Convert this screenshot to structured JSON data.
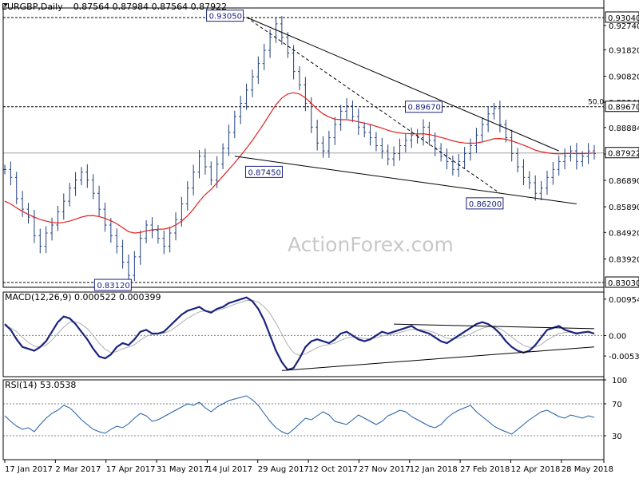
{
  "chart_data": {
    "type": "line",
    "main": {
      "title": "EURGBP,Daily",
      "ohlc": "0.87564 0.87984 0.87564 0.87922",
      "ylim": [
        0.8285,
        0.934
      ],
      "price_ticks": [
        "0.92740",
        "0.91820",
        "0.90820",
        "0.89840",
        "0.88884",
        "0.87880",
        "0.86890",
        "0.85890",
        "0.84920",
        "0.83920"
      ],
      "current_price": "0.87922",
      "level_labels": [
        {
          "text": "0.93040",
          "value": 0.9304,
          "style": "dashed"
        },
        {
          "text": "0.89670",
          "value": 0.8967,
          "style": "dashed",
          "fib_label": "50.0"
        },
        {
          "text": "0.83030",
          "value": 0.8303,
          "style": "dashed"
        }
      ],
      "annotations": [
        {
          "text": "0.93050",
          "date_index": 215,
          "value": 0.9305
        },
        {
          "text": "0.89670",
          "date_index": 365,
          "value": 0.8967
        },
        {
          "text": "0.87450",
          "date_index": 235,
          "value": 0.8745
        },
        {
          "text": "0.86200",
          "date_index": 415,
          "value": 0.862
        },
        {
          "text": "0.83120",
          "date_index": 90,
          "value": 0.8312
        }
      ],
      "series": [
        {
          "type": "ohlc_bars",
          "color": "#1f3f7f",
          "values": [
            0.873,
            0.87,
            0.862,
            0.858,
            0.855,
            0.848,
            0.844,
            0.849,
            0.852,
            0.857,
            0.861,
            0.866,
            0.869,
            0.872,
            0.869,
            0.864,
            0.858,
            0.852,
            0.848,
            0.844,
            0.838,
            0.833,
            0.84,
            0.847,
            0.852,
            0.85,
            0.847,
            0.844,
            0.849,
            0.854,
            0.86,
            0.866,
            0.872,
            0.878,
            0.874,
            0.869,
            0.875,
            0.881,
            0.887,
            0.893,
            0.898,
            0.903,
            0.908,
            0.913,
            0.918,
            0.923,
            0.928,
            0.923,
            0.917,
            0.91,
            0.905,
            0.898,
            0.889,
            0.883,
            0.88,
            0.885,
            0.89,
            0.895,
            0.897,
            0.893,
            0.889,
            0.887,
            0.885,
            0.882,
            0.88,
            0.877,
            0.879,
            0.882,
            0.884,
            0.886,
            0.885,
            0.889,
            0.884,
            0.881,
            0.878,
            0.876,
            0.873,
            0.876,
            0.879,
            0.882,
            0.886,
            0.89,
            0.894,
            0.896,
            0.89,
            0.885,
            0.879,
            0.874,
            0.87,
            0.868,
            0.864,
            0.866,
            0.87,
            0.873,
            0.876,
            0.878,
            0.88,
            0.876,
            0.878,
            0.88,
            0.879
          ]
        },
        {
          "type": "moving_average",
          "color": "#e02020",
          "values": [
            0.861,
            0.86,
            0.8585,
            0.8572,
            0.856,
            0.855,
            0.8541,
            0.8535,
            0.853,
            0.8528,
            0.853,
            0.8535,
            0.8542,
            0.855,
            0.8555,
            0.8556,
            0.8552,
            0.8545,
            0.8536,
            0.8525,
            0.851,
            0.8495,
            0.849,
            0.8492,
            0.8498,
            0.8502,
            0.8504,
            0.8505,
            0.851,
            0.852,
            0.8535,
            0.8555,
            0.858,
            0.861,
            0.8635,
            0.8655,
            0.868,
            0.8705,
            0.873,
            0.8755,
            0.8782,
            0.881,
            0.884,
            0.8872,
            0.8905,
            0.894,
            0.8975,
            0.9,
            0.9015,
            0.902,
            0.9015,
            0.9,
            0.898,
            0.8958,
            0.894,
            0.8928,
            0.892,
            0.8918,
            0.8918,
            0.8915,
            0.891,
            0.8905,
            0.89,
            0.8893,
            0.8886,
            0.8878,
            0.8872,
            0.8868,
            0.8866,
            0.8865,
            0.8864,
            0.8865,
            0.8862,
            0.8857,
            0.8851,
            0.8845,
            0.8838,
            0.8833,
            0.883,
            0.8829,
            0.883,
            0.8834,
            0.884,
            0.8846,
            0.8847,
            0.8844,
            0.8838,
            0.883,
            0.8822,
            0.8813,
            0.8803,
            0.8797,
            0.8793,
            0.879,
            0.8789,
            0.879,
            0.8791,
            0.879,
            0.879,
            0.8791,
            0.8792
          ]
        }
      ]
    },
    "x_axis": {
      "tick_labels": [
        "17 Jan 2017",
        "2 Mar 2017",
        "17 Apr 2017",
        "31 May 2017",
        "14 Jul 2017",
        "29 Aug 2017",
        "12 Oct 2017",
        "27 Nov 2017",
        "12 Jan 2018",
        "27 Feb 2018",
        "12 Apr 2018",
        "28 May 2018"
      ],
      "n_points": 101
    },
    "macd": {
      "title": "MACD(12,26,9) 0.000522 0.000399",
      "ylim": [
        -0.0108,
        0.0114
      ],
      "tick_labels": [
        "0.00954",
        "0.00",
        "-0.00538"
      ],
      "series": [
        {
          "name": "MACD",
          "color": "#1a237e",
          "values": [
            0.003,
            0.0015,
            -0.001,
            -0.003,
            -0.0035,
            -0.004,
            -0.003,
            -0.0015,
            0.001,
            0.0035,
            0.005,
            0.0045,
            0.003,
            0.001,
            -0.001,
            -0.0035,
            -0.0055,
            -0.006,
            -0.005,
            -0.003,
            -0.002,
            -0.0025,
            -0.001,
            0.001,
            0.0015,
            0.0005,
            0.0005,
            0.001,
            0.0025,
            0.004,
            0.0055,
            0.0065,
            0.007,
            0.0075,
            0.0065,
            0.006,
            0.007,
            0.0075,
            0.0085,
            0.009,
            0.0095,
            0.01,
            0.009,
            0.007,
            0.004,
            0.0,
            -0.004,
            -0.007,
            -0.009,
            -0.0085,
            -0.006,
            -0.003,
            -0.0015,
            -0.001,
            -0.0015,
            -0.002,
            -0.001,
            0.0005,
            0.001,
            0.0,
            -0.001,
            -0.0015,
            -0.001,
            0.0,
            0.001,
            0.0005,
            0.001,
            0.0015,
            0.002,
            0.0025,
            0.0015,
            0.001,
            0.0005,
            -0.0005,
            -0.0015,
            -0.002,
            -0.001,
            0.0,
            0.001,
            0.002,
            0.003,
            0.0035,
            0.003,
            0.002,
            0.0005,
            -0.0015,
            -0.003,
            -0.004,
            -0.0045,
            -0.004,
            -0.0025,
            -0.0005,
            0.0015,
            0.002,
            0.0025,
            0.0015,
            0.001,
            0.0005,
            0.0008,
            0.001,
            0.0005
          ]
        },
        {
          "name": "Signal",
          "color": "#b0b0b0",
          "values": [
            0.0025,
            0.002,
            0.001,
            -0.0005,
            -0.0018,
            -0.0028,
            -0.003,
            -0.0025,
            -0.0012,
            0.0005,
            0.0022,
            0.0035,
            0.0036,
            0.003,
            0.0018,
            0.0,
            -0.002,
            -0.0036,
            -0.0045,
            -0.0042,
            -0.0035,
            -0.003,
            -0.0024,
            -0.0012,
            -0.0002,
            0.0003,
            0.0004,
            0.0006,
            0.0012,
            0.0022,
            0.0034,
            0.0045,
            0.0054,
            0.0062,
            0.0065,
            0.0064,
            0.0066,
            0.007,
            0.0076,
            0.0082,
            0.0087,
            0.0092,
            0.0092,
            0.0088,
            0.0076,
            0.0058,
            0.0032,
            0.0004,
            -0.0025,
            -0.0045,
            -0.0052,
            -0.0048,
            -0.004,
            -0.0032,
            -0.0026,
            -0.0024,
            -0.002,
            -0.0013,
            -0.0006,
            -0.0004,
            -0.0005,
            -0.0008,
            -0.0009,
            -0.0006,
            -0.0001,
            0.0001,
            0.0004,
            0.0008,
            0.0012,
            0.0016,
            0.0016,
            0.0015,
            0.0012,
            0.0007,
            0.0,
            -0.0007,
            -0.0009,
            -0.0007,
            -0.0002,
            0.0004,
            0.0012,
            0.0019,
            0.0023,
            0.0023,
            0.0018,
            0.0008,
            -0.0004,
            -0.0016,
            -0.0026,
            -0.0031,
            -0.003,
            -0.0023,
            -0.0012,
            -0.0003,
            0.0005,
            0.0008,
            0.0009,
            0.0008,
            0.0008,
            0.0008,
            0.0004
          ]
        }
      ]
    },
    "rsi": {
      "title": "RSI(14) 53.0538",
      "ylim": [
        0,
        100
      ],
      "tick_labels": [
        "100",
        "70",
        "30",
        "0"
      ],
      "levels": [
        70,
        30
      ],
      "series": [
        {
          "name": "RSI",
          "color": "#1f5ea8",
          "values": [
            55,
            48,
            42,
            38,
            40,
            35,
            44,
            52,
            58,
            62,
            68,
            65,
            58,
            50,
            44,
            38,
            35,
            33,
            38,
            42,
            40,
            45,
            52,
            58,
            55,
            48,
            50,
            54,
            58,
            62,
            66,
            70,
            68,
            72,
            65,
            60,
            66,
            70,
            74,
            76,
            78,
            80,
            75,
            68,
            58,
            48,
            40,
            35,
            32,
            38,
            45,
            52,
            50,
            55,
            60,
            56,
            48,
            46,
            44,
            50,
            56,
            52,
            48,
            44,
            48,
            55,
            58,
            62,
            60,
            54,
            50,
            46,
            42,
            40,
            44,
            52,
            58,
            62,
            65,
            68,
            60,
            54,
            48,
            42,
            38,
            35,
            32,
            38,
            44,
            50,
            55,
            60,
            62,
            58,
            54,
            52,
            56,
            54,
            52,
            55,
            53
          ]
        }
      ]
    },
    "watermark": "ActionForex.com"
  }
}
